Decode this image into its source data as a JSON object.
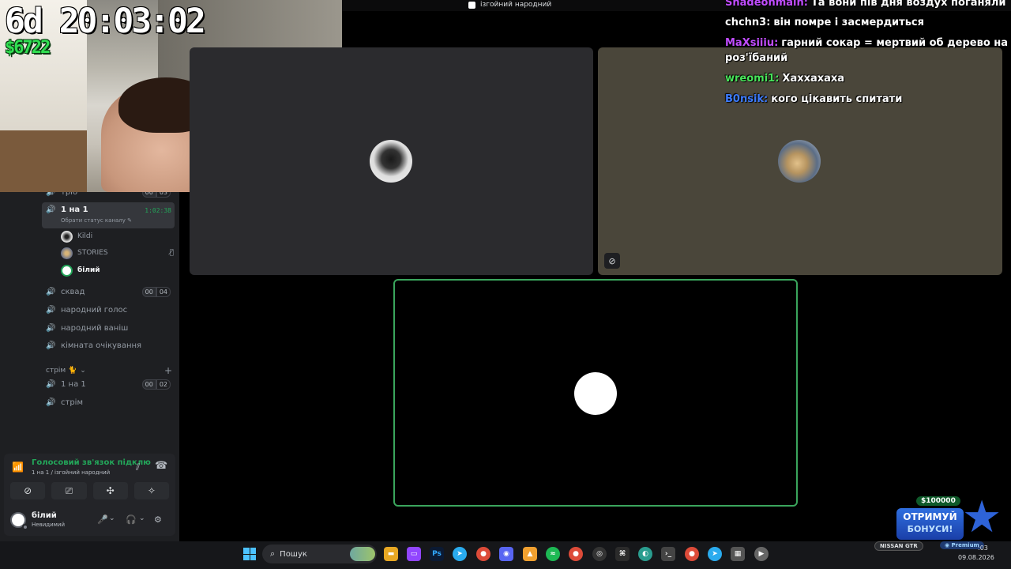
{
  "window": {
    "title": "ізгойний народний"
  },
  "stream": {
    "timer": "6d 20:03:02",
    "money": "$6722"
  },
  "chat": [
    {
      "nick": "Shadeonmain:",
      "text": "Та вони пів дня воздух поганяли",
      "color": "#c04cff"
    },
    {
      "nick": "chchn3:",
      "text": "він помре і засмердиться",
      "color": "#ffffff"
    },
    {
      "nick": "MaXsiiiu:",
      "text": "гарний сокар = мертвий об дерево на бмв",
      "color": "#c04cff"
    },
    {
      "nick": "",
      "text": "роз'їбаний",
      "color": "#ffffff"
    },
    {
      "nick": "wreomi1:",
      "text": "Хаххахаха",
      "color": "#48e45a"
    },
    {
      "nick": "B0nsik:",
      "text": "кого цікавить спитати",
      "color": "#3d7cff"
    }
  ],
  "sidebar": {
    "channels": [
      {
        "label": "тріо",
        "count_a": "00",
        "count_b": "03"
      },
      {
        "label": "1 на 1",
        "time": "1:02:38",
        "sub": "Обрати статус каналу"
      },
      {
        "label": "сквад",
        "count_a": "00",
        "count_b": "04"
      },
      {
        "label": "народний голос"
      },
      {
        "label": "народний ваніш"
      },
      {
        "label": "кімната очікування"
      }
    ],
    "members": [
      {
        "name": "Kildi"
      },
      {
        "name": "STORIES"
      },
      {
        "name": "білий"
      }
    ],
    "section": {
      "label": "стрім 🐈"
    },
    "section_channels": [
      {
        "label": "1 на 1",
        "count_a": "00",
        "count_b": "02"
      },
      {
        "label": "стрім"
      }
    ]
  },
  "voice": {
    "status": "Голосовий зв'язок підклю",
    "location": "1 на 1 / ізгойний народний"
  },
  "user": {
    "name": "білий",
    "status": "Невидимий"
  },
  "promo": {
    "amount": "$100000",
    "line1": "ОТРИМУЙ",
    "line2": "БОНУСИ!"
  },
  "taskbar": {
    "search_placeholder": "Пошук",
    "tray_badge": "NISSAN GTR",
    "premium": "Premium",
    "time": ":03",
    "date": "09.08.2026"
  }
}
